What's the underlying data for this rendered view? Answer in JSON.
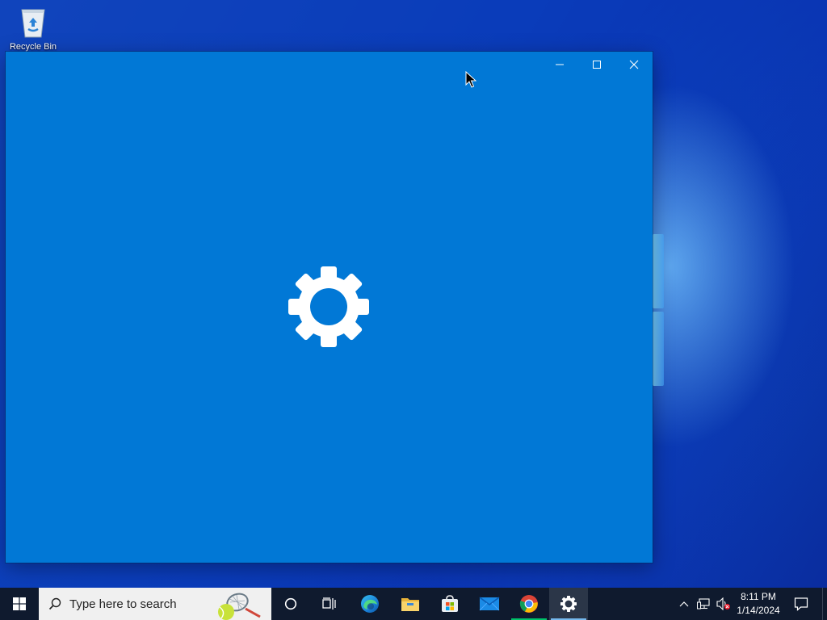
{
  "desktop": {
    "icons": [
      {
        "label": "Recycle Bin",
        "icon": "recycle-bin-icon"
      }
    ]
  },
  "window": {
    "app": "Settings",
    "state": "loading-splash",
    "background_color": "#0178d6",
    "controls": {
      "minimize": "minimize-icon",
      "maximize": "maximize-icon",
      "close": "close-icon"
    },
    "splash_icon": "gear-icon"
  },
  "taskbar": {
    "background_color": "#0f1a2e",
    "search": {
      "placeholder": "Type here to search"
    },
    "pinned": [
      {
        "name": "Cortana",
        "icon": "cortana-icon"
      },
      {
        "name": "Task View",
        "icon": "task-view-icon"
      },
      {
        "name": "Microsoft Edge",
        "icon": "edge-icon"
      },
      {
        "name": "File Explorer",
        "icon": "folder-icon"
      },
      {
        "name": "Microsoft Store",
        "icon": "store-icon"
      },
      {
        "name": "Mail",
        "icon": "mail-icon"
      },
      {
        "name": "Google Chrome",
        "icon": "chrome-icon",
        "running": true
      },
      {
        "name": "Settings",
        "icon": "gear-icon",
        "running": true,
        "active": true
      }
    ],
    "tray": {
      "time": "8:11 PM",
      "date": "1/14/2024",
      "icons": [
        "chevron-up-icon",
        "network-icon",
        "volume-muted-icon",
        "notification-icon"
      ]
    }
  }
}
